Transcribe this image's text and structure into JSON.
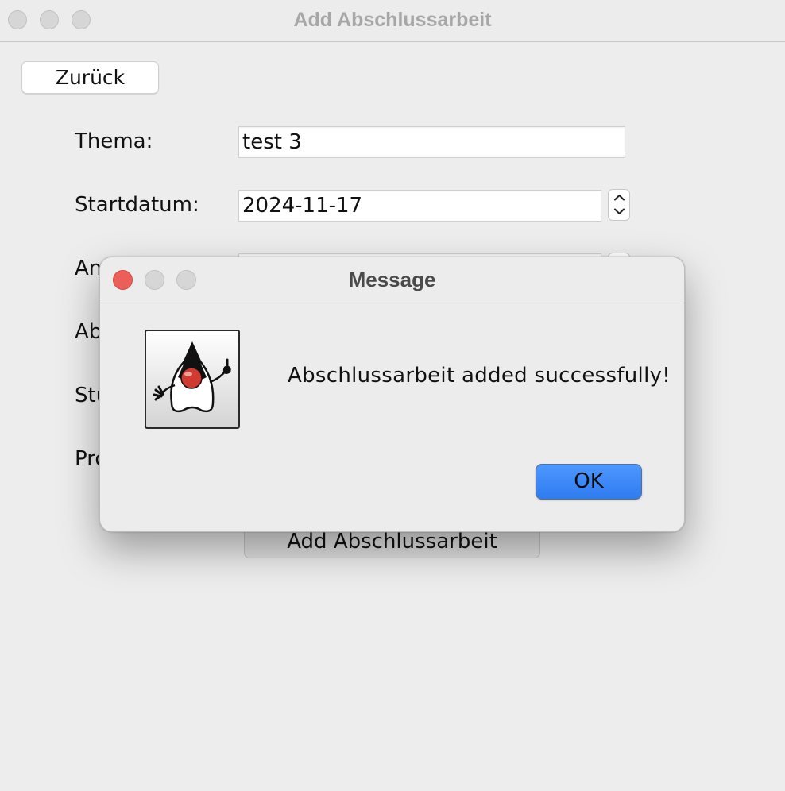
{
  "window": {
    "title": "Add Abschlussarbeit",
    "back_label": "Zurück",
    "submit_label": "Add Abschlussarbeit"
  },
  "form": {
    "thema_label": "Thema:",
    "thema_value": "test 3",
    "startdatum_label": "Startdatum:",
    "startdatum_value": "2024-11-17",
    "row3_label_partial": "An",
    "row4_label_partial": "Ab",
    "row5_label_partial": "Stu",
    "row6_label_partial": "Pro"
  },
  "dialog": {
    "title": "Message",
    "message": "Abschlussarbeit added successfully!",
    "ok_label": "OK",
    "icon": "java-duke-icon"
  },
  "colors": {
    "close_red": "#ec5f58",
    "ok_blue": "#3a86f6",
    "background": "#ececec"
  }
}
